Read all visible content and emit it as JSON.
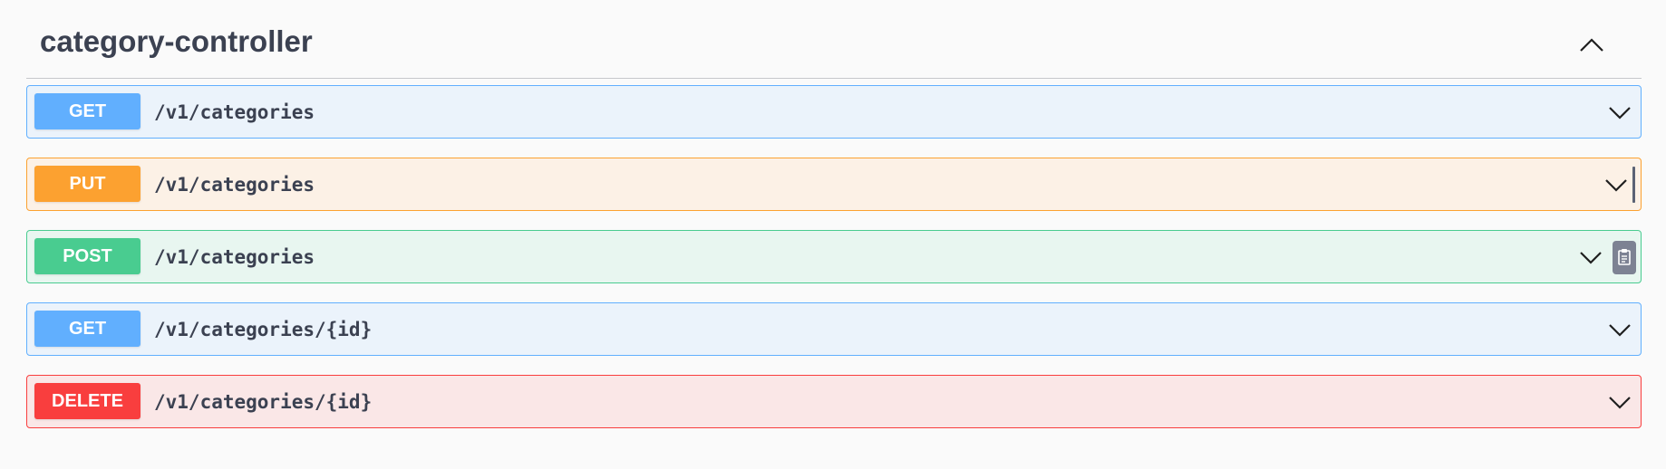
{
  "section": {
    "title": "category-controller",
    "toggle_icon": "chevron-up-icon"
  },
  "operations": [
    {
      "method": "GET",
      "path": "/v1/categories"
    },
    {
      "method": "PUT",
      "path": "/v1/categories"
    },
    {
      "method": "POST",
      "path": "/v1/categories"
    },
    {
      "method": "GET",
      "path": "/v1/categories/{id}"
    },
    {
      "method": "DELETE",
      "path": "/v1/categories/{id}"
    }
  ],
  "icons": {
    "expand": "chevron-down-icon",
    "copy": "copy-to-clipboard-icon"
  },
  "colors": {
    "get": "#61affe",
    "put": "#fca130",
    "post": "#49cc90",
    "delete": "#f93e3e",
    "title_text": "#3b4151"
  }
}
